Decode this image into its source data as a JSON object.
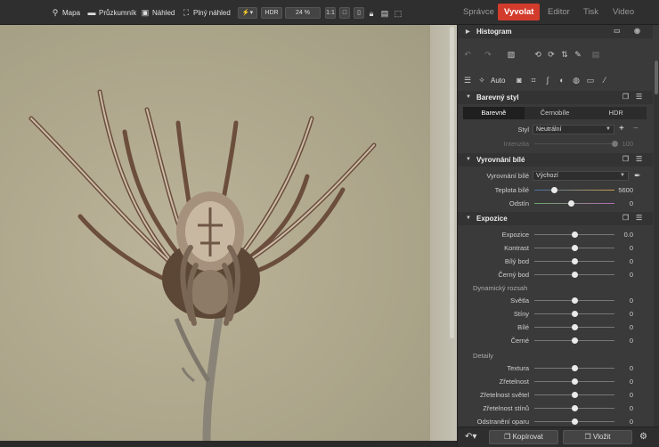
{
  "topbar": {
    "map_label": "Mapa",
    "explorer_label": "Průzkumník",
    "preview_label": "Náhled",
    "fullscreen_label": "Plný náhled",
    "hdr_label": "HDR",
    "zoom_value": "24 %",
    "one_to_one": "1:1",
    "tabs": [
      "Správce",
      "Vyvolat",
      "Editor",
      "Tisk",
      "Video"
    ],
    "active_tab_color": "#d33b2c"
  },
  "panel": {
    "histogram_title": "Histogram",
    "auto_label": "Auto",
    "color_style": {
      "title": "Barevný styl",
      "seg_color": "Barevně",
      "seg_bw": "Černobíle",
      "seg_hdr": "HDR",
      "style_label": "Styl",
      "style_value": "Neutrální",
      "intensity_label": "Intenzita",
      "intensity_value": "100"
    },
    "white_balance": {
      "title": "Vyrovnání bílé",
      "wb_label": "Vyrovnání bílé",
      "wb_value": "Výchozí",
      "temp_label": "Teplota bílé",
      "temp_value": "5600",
      "tint_label": "Odstín",
      "tint_value": "0"
    },
    "exposure": {
      "title": "Expozice",
      "rows": [
        {
          "label": "Expozice",
          "value": "0.0",
          "pos": 0.5
        },
        {
          "label": "Kontrast",
          "value": "0",
          "pos": 0.5
        },
        {
          "label": "Bílý bod",
          "value": "0",
          "pos": 0.5
        },
        {
          "label": "Černý bod",
          "value": "0",
          "pos": 0.5
        }
      ],
      "dynamic_range_label": "Dynamický rozsah",
      "dr_rows": [
        {
          "label": "Světla",
          "value": "0",
          "pos": 0.5
        },
        {
          "label": "Stíny",
          "value": "0",
          "pos": 0.5
        },
        {
          "label": "Bílé",
          "value": "0",
          "pos": 0.5
        },
        {
          "label": "Černé",
          "value": "0",
          "pos": 0.5
        }
      ],
      "details_label": "Detaily",
      "detail_rows": [
        {
          "label": "Textura",
          "value": "0",
          "pos": 0.5
        },
        {
          "label": "Zřetelnost",
          "value": "0",
          "pos": 0.5
        },
        {
          "label": "Zřetelnost světel",
          "value": "0",
          "pos": 0.5
        },
        {
          "label": "Zřetelnost stínů",
          "value": "0",
          "pos": 0.5
        },
        {
          "label": "Odstranění oparu",
          "value": "0",
          "pos": 0.5
        }
      ]
    },
    "copy_label": "Kopírovat",
    "paste_label": "Vložit"
  }
}
